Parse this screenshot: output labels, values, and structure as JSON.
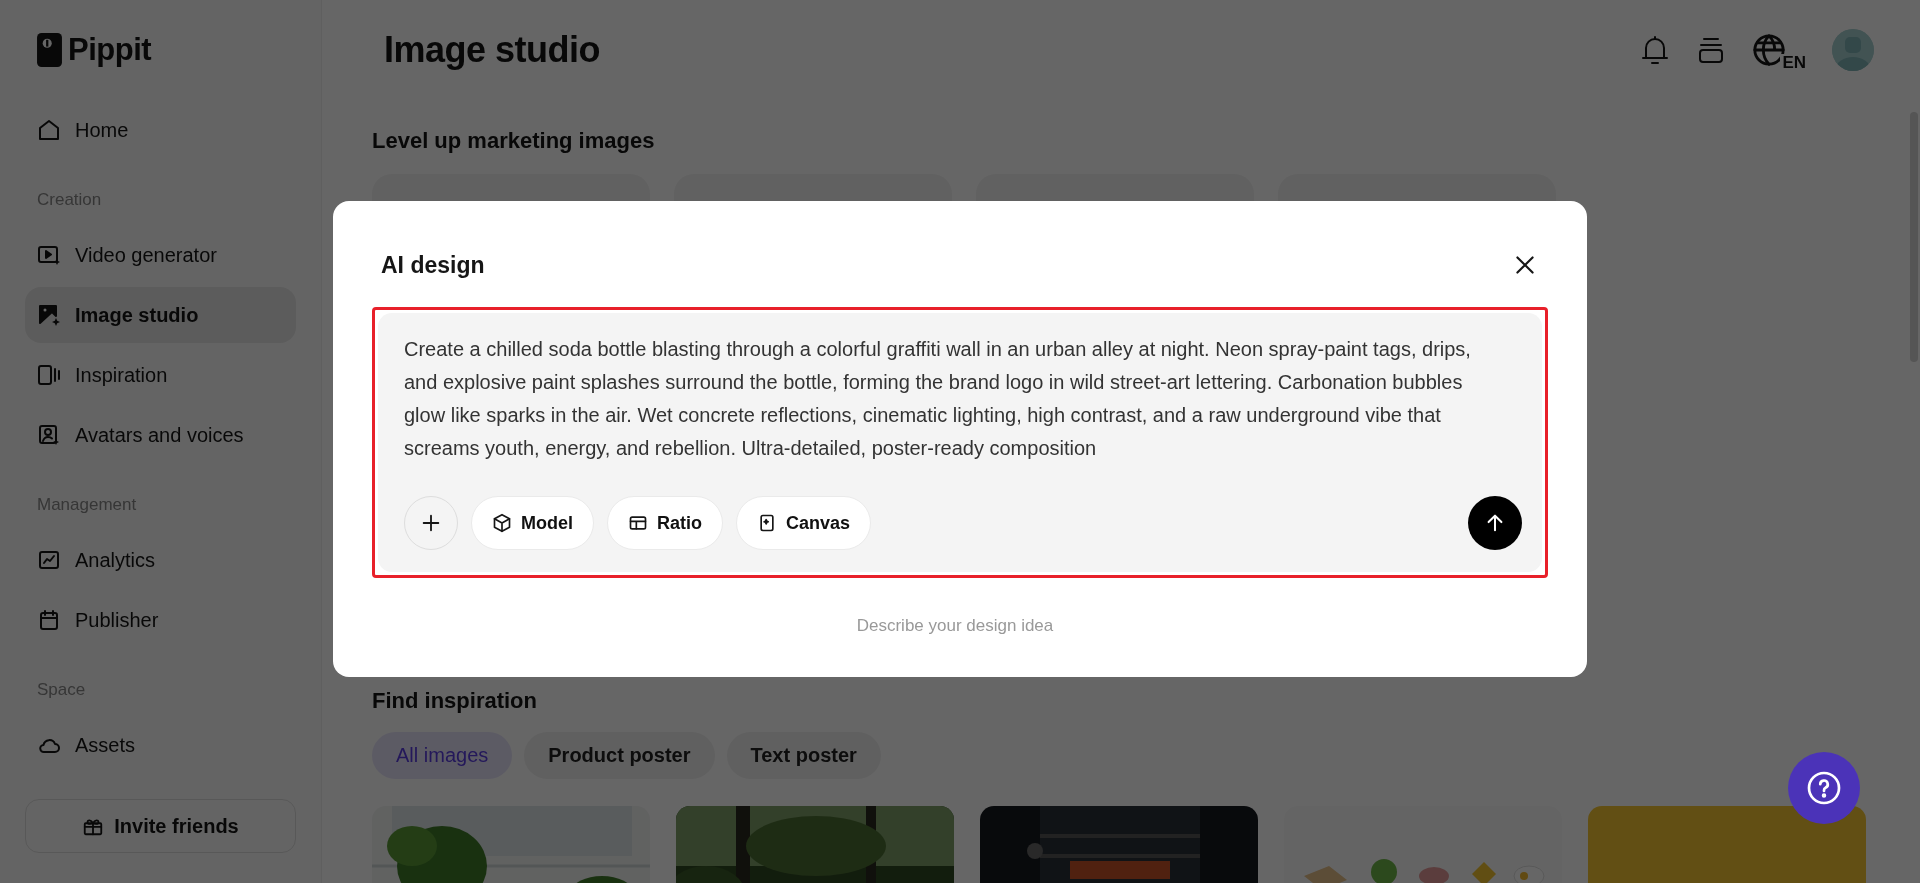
{
  "sidebar": {
    "logo": "Pippit",
    "sections": [
      {
        "items": [
          {
            "label": "Home",
            "selected": false
          }
        ]
      },
      {
        "label": "Creation",
        "items": [
          {
            "label": "Video generator",
            "selected": false
          },
          {
            "label": "Image studio",
            "selected": true
          },
          {
            "label": "Inspiration",
            "selected": false
          },
          {
            "label": "Avatars and voices",
            "selected": false
          }
        ]
      },
      {
        "label": "Management",
        "items": [
          {
            "label": "Analytics",
            "selected": false
          },
          {
            "label": "Publisher",
            "selected": false
          }
        ]
      },
      {
        "label": "Space",
        "items": [
          {
            "label": "Assets",
            "selected": false
          }
        ]
      }
    ],
    "invite_button": "Invite friends"
  },
  "header": {
    "title": "Image studio",
    "language": "EN"
  },
  "marketing": {
    "title": "Level up marketing images"
  },
  "inspiration": {
    "title": "Find inspiration",
    "filters": [
      {
        "label": "All images",
        "selected": true
      },
      {
        "label": "Product poster",
        "selected": false
      },
      {
        "label": "Text poster",
        "selected": false
      }
    ]
  },
  "dialog": {
    "title": "AI design",
    "prompt": {
      "value": "Create a chilled soda bottle blasting through a colorful graffiti wall in an urban alley at night. Neon spray-paint tags, drips, and explosive paint splashes surround the bottle, forming the brand logo in wild street-art lettering. Carbonation bubbles glow like sparks in the air. Wet concrete reflections, cinematic lighting, high contrast, and a raw underground vibe that screams youth, energy, and rebellion. Ultra-detailed, poster-ready composition",
      "focused": true
    },
    "tools": [
      "Model",
      "Ratio",
      "Canvas"
    ],
    "hint": "Describe your design idea"
  }
}
